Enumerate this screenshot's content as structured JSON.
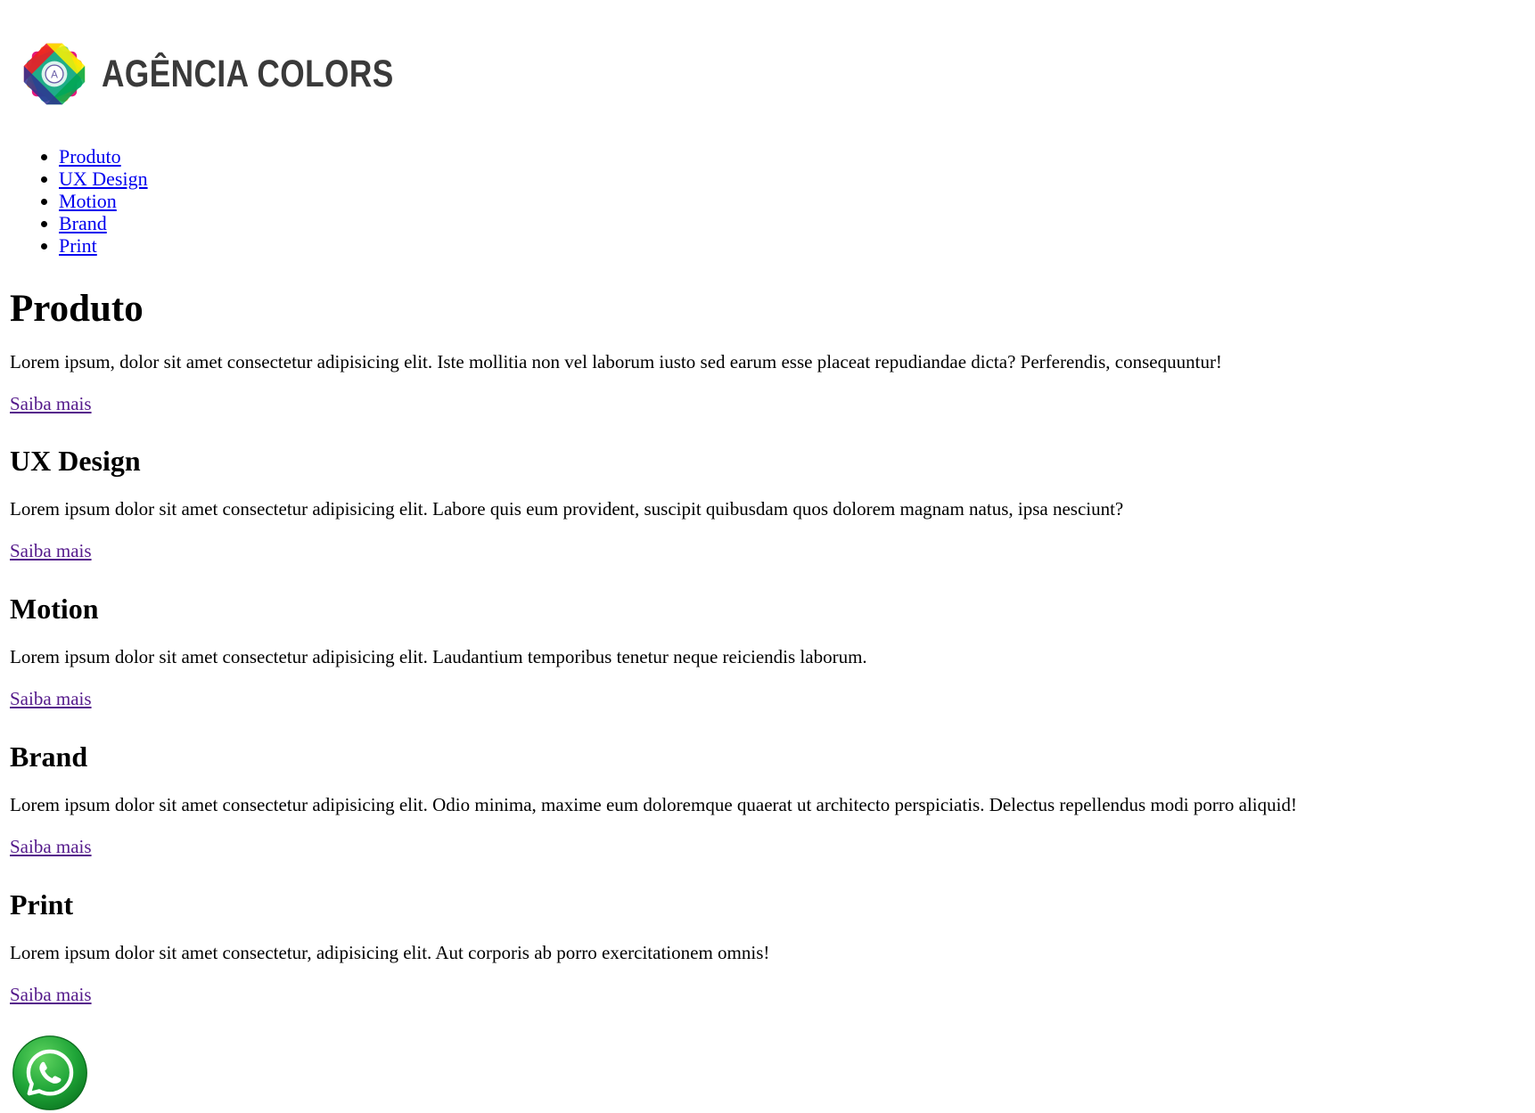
{
  "header": {
    "logo_text": "AGÊNCIA COLORS",
    "logo_icon": "colorful-flower-logo-icon"
  },
  "nav": {
    "items": [
      {
        "label": "Produto"
      },
      {
        "label": "UX Design"
      },
      {
        "label": "Motion"
      },
      {
        "label": "Brand"
      },
      {
        "label": "Print"
      }
    ]
  },
  "sections": [
    {
      "title": "Produto",
      "text": "Lorem ipsum, dolor sit amet consectetur adipisicing elit. Iste mollitia non vel laborum iusto sed earum esse placeat repudiandae dicta? Perferendis, consequuntur!",
      "link": "Saiba mais"
    },
    {
      "title": "UX Design",
      "text": "Lorem ipsum dolor sit amet consectetur adipisicing elit. Labore quis eum provident, suscipit quibusdam quos dolorem magnam natus, ipsa nesciunt?",
      "link": "Saiba mais"
    },
    {
      "title": "Motion",
      "text": "Lorem ipsum dolor sit amet consectetur adipisicing elit. Laudantium temporibus tenetur neque reiciendis laborum.",
      "link": "Saiba mais"
    },
    {
      "title": "Brand",
      "text": "Lorem ipsum dolor sit amet consectetur adipisicing elit. Odio minima, maxime eum doloremque quaerat ut architecto perspiciatis. Delectus repellendus modi porro aliquid!",
      "link": "Saiba mais"
    },
    {
      "title": "Print",
      "text": "Lorem ipsum dolor sit amet consectetur, adipisicing elit. Aut corporis ab porro exercitationem omnis!",
      "link": "Saiba mais"
    }
  ],
  "footer": {
    "whatsapp_icon": "whatsapp-icon"
  },
  "colors": {
    "link": "#0000ee",
    "link_visited": "#551a8b",
    "whatsapp_green": "#1fa538",
    "logo_text": "#3a3a3a"
  }
}
